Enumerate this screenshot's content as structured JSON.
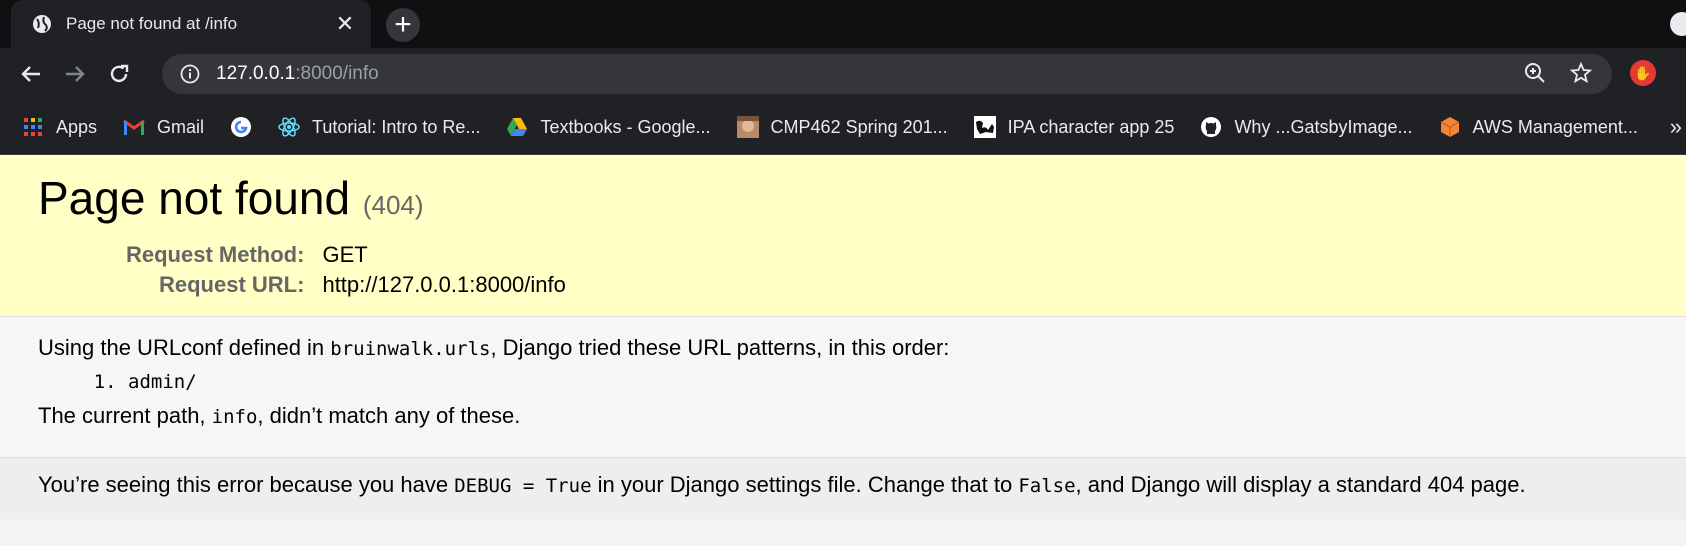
{
  "browser": {
    "tab_title": "Page not found at /info",
    "url_host": "127.0.0.1",
    "url_rest": ":8000/info",
    "bookmarks": [
      {
        "label": "Apps",
        "icon": "apps-grid-icon"
      },
      {
        "label": "Gmail",
        "icon": "gmail-icon"
      },
      {
        "label": "",
        "icon": "google-icon"
      },
      {
        "label": "Tutorial: Intro to Re...",
        "icon": "react-icon"
      },
      {
        "label": "Textbooks - Google...",
        "icon": "google-drive-icon"
      },
      {
        "label": "CMP462 Spring 201...",
        "icon": "photo-icon"
      },
      {
        "label": "IPA character app 25",
        "icon": "map-icon"
      },
      {
        "label": "Why ...GatsbyImage...",
        "icon": "github-icon"
      },
      {
        "label": "AWS Management...",
        "icon": "aws-icon"
      }
    ]
  },
  "page": {
    "title": "Page not found",
    "code": "(404)",
    "meta": [
      {
        "label": "Request Method:",
        "value": "GET"
      },
      {
        "label": "Request URL:",
        "value": "http://127.0.0.1:8000/info"
      }
    ],
    "urlconf_prefix": "Using the URLconf defined in ",
    "urlconf_module": "bruinwalk.urls",
    "urlconf_suffix": ", Django tried these URL patterns, in this order:",
    "patterns": [
      "admin/"
    ],
    "path_prefix": "The current path, ",
    "path_value": "info",
    "path_suffix": ", didn’t match any of these.",
    "debug_prefix": "You’re seeing this error because you have ",
    "debug_code": "DEBUG = True",
    "debug_mid": " in your Django settings file. Change that to ",
    "debug_false": "False",
    "debug_suffix": ", and Django will display a standard 404 page."
  }
}
